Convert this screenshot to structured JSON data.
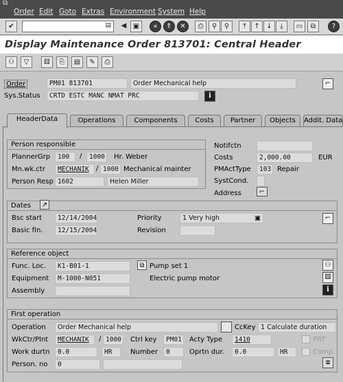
{
  "menu": [
    "Order",
    "Edit",
    "Goto",
    "Extras",
    "Environment",
    "System",
    "Help"
  ],
  "page_title": "Display Maintenance Order 813701: Central Header",
  "header": {
    "order_label": "Order",
    "order_type": "PM01",
    "order_number": "813701",
    "order_desc": "Order Mechanical help",
    "sys_status_label": "Sys.Status",
    "sys_status": "CRTD ESTC MANC NMAT PRC"
  },
  "tabs": [
    {
      "label": "HeaderData",
      "active": true
    },
    {
      "label": "Operations"
    },
    {
      "label": "Components"
    },
    {
      "label": "Costs"
    },
    {
      "label": "Partner"
    },
    {
      "label": "Objects"
    },
    {
      "label": "Addit. Data"
    }
  ],
  "person_responsible": {
    "title": "Person responsible",
    "planner_grp_label": "PlannerGrp",
    "planner_grp": "100",
    "planner_plant": "1000",
    "planner_name": "Hr. Weber",
    "mnwkctr_label": "Mn.wk.ctr",
    "mnwkctr": "MECHANIK",
    "mnwkctr_plant": "1000",
    "mnwkctr_desc": "Mechanical mainter",
    "person_resp_label": "Person Resp",
    "person_resp": "1602",
    "person_resp_name": "Helen Miller"
  },
  "right_info": {
    "notifctn_label": "Notifctn",
    "notifctn": "",
    "costs_label": "Costs",
    "costs": "2,000.00",
    "currency": "EUR",
    "pmacttype_label": "PMActType",
    "pmacttype": "103",
    "pmacttype_desc": "Repair",
    "systcond_label": "SystCond.",
    "systcond": "",
    "address_label": "Address"
  },
  "dates": {
    "title": "Dates",
    "bsc_start_label": "Bsc start",
    "bsc_start": "12/14/2004",
    "basic_fin_label": "Basic fin.",
    "basic_fin": "12/15/2004",
    "priority_label": "Priority",
    "priority": "1 Very high",
    "revision_label": "Revision",
    "revision": ""
  },
  "reference_object": {
    "title": "Reference object",
    "func_loc_label": "Func. Loc.",
    "func_loc": "K1-B01-1",
    "func_loc_desc": "Pump set 1",
    "equipment_label": "Equipment",
    "equipment": "M-1000-N051",
    "equipment_desc": "Electric pump motor",
    "assembly_label": "Assembly",
    "assembly": ""
  },
  "first_operation": {
    "title": "First operation",
    "operation_label": "Operation",
    "operation": "Order Mechanical help",
    "cckey_label": "CcKey",
    "cckey": "1 Calculate duration",
    "wkctr_label": "WkCtr/Plnt",
    "wkctr": "MECHANIK",
    "wkctr_plant": "1000",
    "ctrl_key_label": "Ctrl key",
    "ctrl_key": "PM01",
    "acty_type_label": "Acty Type",
    "acty_type": "1410",
    "prt_label": "PRT",
    "work_durtn_label": "Work durtn",
    "work_durtn": "0.0",
    "work_unit": "HR",
    "number_label": "Number",
    "number": "0",
    "oprtn_dur_label": "Oprtn dur.",
    "oprtn_dur": "0.0",
    "oprtn_unit": "HR",
    "comp_label": "Comp.",
    "person_no_label": "Person. no",
    "person_no": "0"
  },
  "colors": {
    "menubar": "#4a4a4a",
    "background": "#c6c6c6",
    "field": "#dcdcdc"
  }
}
